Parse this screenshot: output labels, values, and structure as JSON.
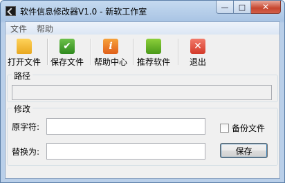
{
  "window": {
    "title": "软件信息修改器V1.0 - 新软工作室",
    "min": "—",
    "max": "□",
    "close": "✕"
  },
  "menu": [
    "文件",
    "帮助"
  ],
  "toolbar": {
    "open": "打开文件",
    "save": "保存文件",
    "help": "帮助中心",
    "recommend": "推荐软件",
    "exit": "退出",
    "help_glyph": "i",
    "exit_glyph": "✕",
    "save_glyph": "✔"
  },
  "path_group": {
    "legend": "路径",
    "value": ""
  },
  "modify_group": {
    "legend": "修改",
    "original_label": "原字符:",
    "original_value": "",
    "replace_label": "替换为:",
    "replace_value": "",
    "backup_label": "备份文件",
    "backup_checked": false,
    "save_button": "保存"
  }
}
